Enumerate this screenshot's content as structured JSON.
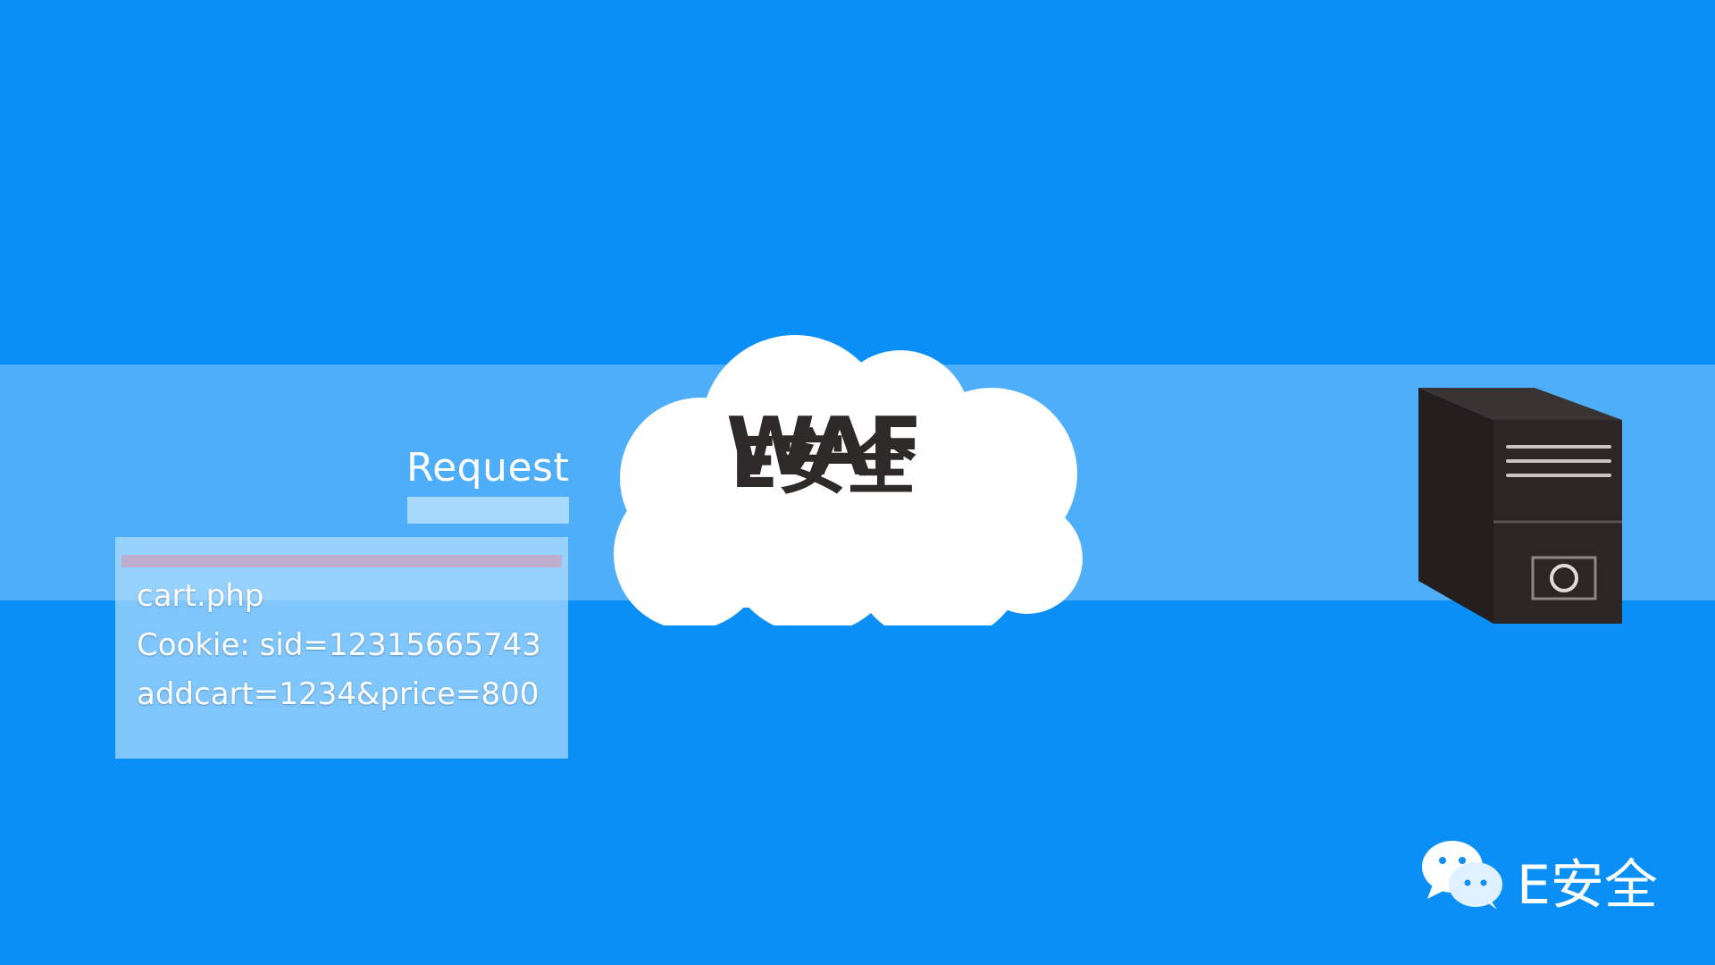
{
  "diagram": {
    "request": {
      "label": "Request",
      "lines": [
        "cart.php",
        "Cookie: sid=12315665743",
        "addcart=1234&price=800"
      ]
    },
    "waf": {
      "label": "WAF",
      "watermark": "E安全"
    },
    "brand": {
      "text": "E安全"
    },
    "colors": {
      "background": "#0a8ff7",
      "cloud": "#ffffff",
      "server": "#2b2525",
      "accent_bar": "#c3a8c9"
    },
    "icons": {
      "cloud": "cloud-icon",
      "server": "server-icon",
      "wechat": "wechat-icon"
    }
  }
}
